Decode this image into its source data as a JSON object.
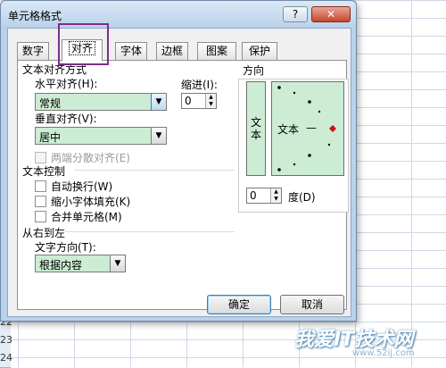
{
  "window": {
    "title": "单元格格式",
    "help_label": "?",
    "close_label": "✕"
  },
  "tabs": [
    {
      "label": "数字",
      "active": false
    },
    {
      "label": "对齐",
      "active": true
    },
    {
      "label": "字体",
      "active": false
    },
    {
      "label": "边框",
      "active": false
    },
    {
      "label": "图案",
      "active": false
    },
    {
      "label": "保护",
      "active": false
    }
  ],
  "alignment": {
    "section_title": "文本对齐方式",
    "horizontal_label": "水平对齐(H):",
    "horizontal_value": "常规",
    "vertical_label": "垂直对齐(V):",
    "vertical_value": "居中",
    "indent_label": "缩进(I):",
    "indent_value": "0",
    "distributed_label": "两端分散对齐(E)"
  },
  "text_control": {
    "section_title": "文本控制",
    "wrap_label": "自动换行(W)",
    "shrink_label": "缩小字体填充(K)",
    "merge_label": "合并单元格(M)"
  },
  "rtl": {
    "section_title": "从右到左",
    "direction_label": "文字方向(T):",
    "direction_value": "根据内容"
  },
  "orientation": {
    "section_title": "方向",
    "vertical_text": "文本",
    "dial_text": "文本",
    "dial_line": "—",
    "degree_value": "0",
    "degree_label": "度(D)"
  },
  "buttons": {
    "ok": "确定",
    "cancel": "取消"
  },
  "sheet_rows": [
    "22",
    "23",
    "24"
  ],
  "watermark": {
    "text": "我爱IT技术网",
    "url": "www.52ij.com"
  },
  "colors": {
    "field_green": "#ccecd4",
    "frame_blue": "#b9d1ea",
    "highlight": "#7b2d8e"
  }
}
